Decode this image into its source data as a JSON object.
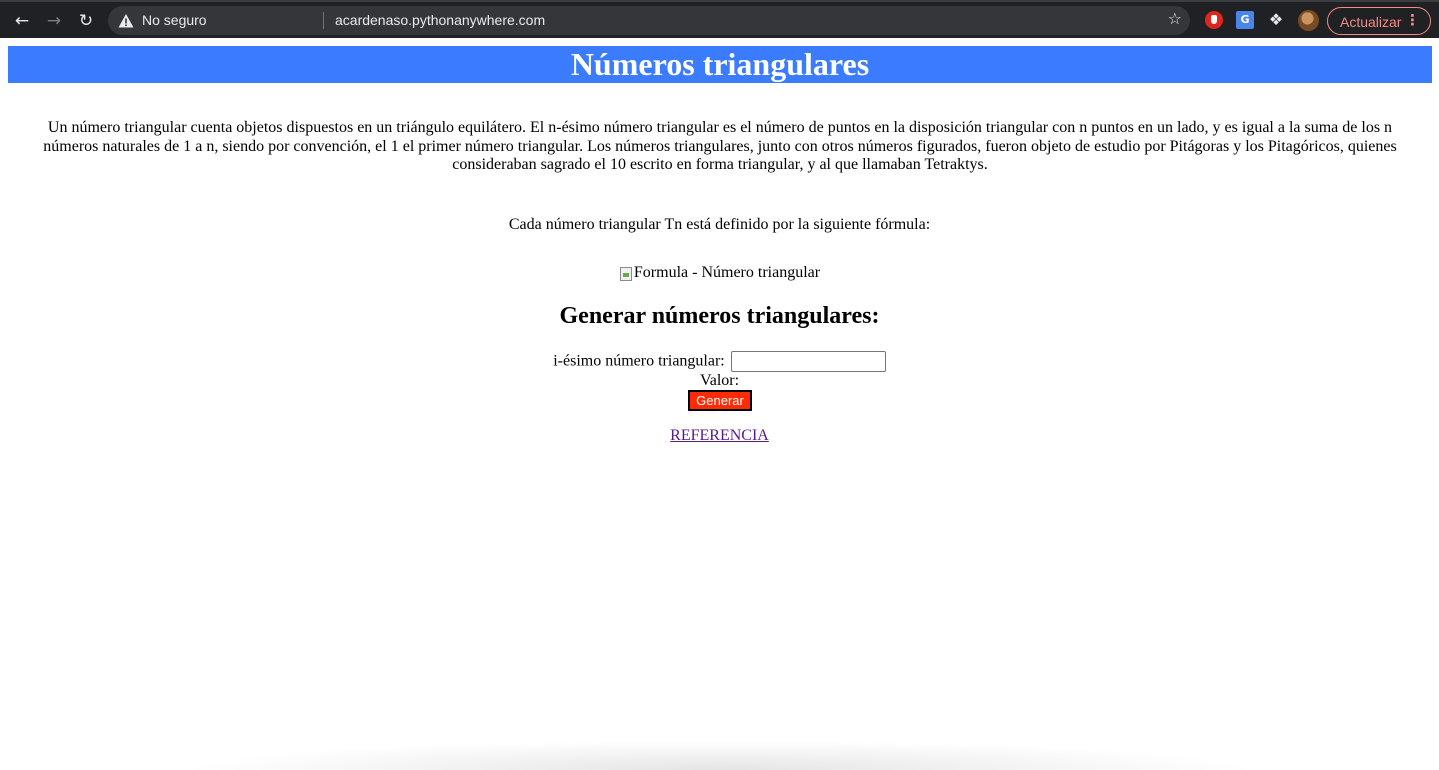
{
  "browser": {
    "back_icon": "arrow-left-icon",
    "forward_icon": "arrow-right-icon",
    "reload_icon": "reload-icon",
    "security_label": "No seguro",
    "url": "acardenaso.pythonanywhere.com",
    "update_label": "Actualizar",
    "translate_glyph": "G"
  },
  "page": {
    "title": "Números triangulares",
    "title_bg": "#3b7cff",
    "intro": "Un número triangular cuenta objetos dispuestos en un triángulo equilátero. El n-ésimo número triangular es el número de puntos en la disposición triangular con n puntos en un lado, y es igual a la suma de los n números naturales de 1 a n, siendo por convención, el 1 el primer número triangular. Los números triangulares, junto con otros números figurados, fueron objeto de estudio por Pitágoras y los Pitagóricos, quienes consideraban sagrado el 10 escrito en forma triangular, y al que llamaban Tetraktys.",
    "formula_text": "Cada número triangular Tn está definido por la siguiente fórmula:",
    "formula_img_alt": "Formula - Número triangular",
    "section_heading": "Generar números triangulares:",
    "form": {
      "input_label": "i-ésimo número triangular:",
      "input_value": "",
      "result_label": "Valor:",
      "result_value": "",
      "button_label": "Generar",
      "button_color": "#ff2b06"
    },
    "reference_link": "REFERENCIA"
  }
}
